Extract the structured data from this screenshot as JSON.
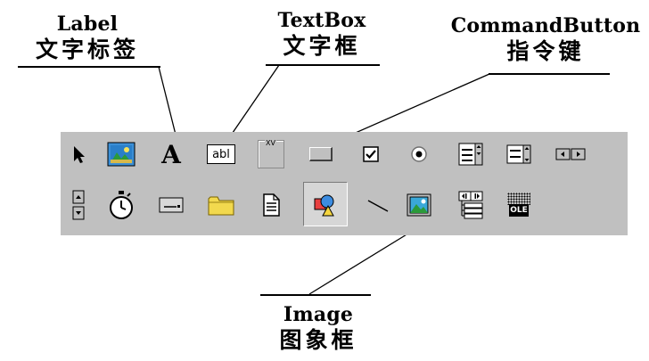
{
  "callouts": {
    "label": {
      "en": "Label",
      "cn": "文字标签"
    },
    "textbox": {
      "en": "TextBox",
      "cn": "文字框"
    },
    "commandbutton": {
      "en": "CommandButton",
      "cn": "指令键"
    },
    "image": {
      "en": "Image",
      "cn": "图象框"
    }
  },
  "toolbox": {
    "label_glyph": "A",
    "textbox_glyph": "abl",
    "frame_glyph": "XV",
    "ole_glyph": "OLE"
  }
}
